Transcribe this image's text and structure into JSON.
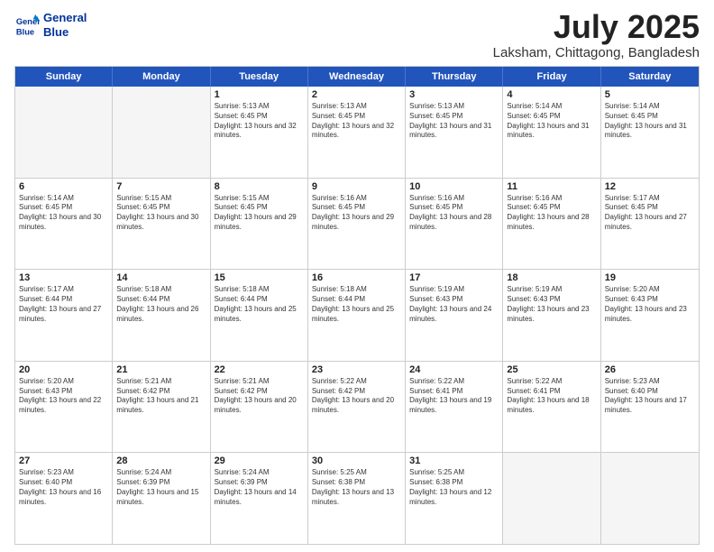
{
  "header": {
    "logo_line1": "General",
    "logo_line2": "Blue",
    "month": "July 2025",
    "location": "Laksham, Chittagong, Bangladesh"
  },
  "weekdays": [
    "Sunday",
    "Monday",
    "Tuesday",
    "Wednesday",
    "Thursday",
    "Friday",
    "Saturday"
  ],
  "rows": [
    [
      {
        "day": "",
        "info": ""
      },
      {
        "day": "",
        "info": ""
      },
      {
        "day": "1",
        "info": "Sunrise: 5:13 AM\nSunset: 6:45 PM\nDaylight: 13 hours and 32 minutes."
      },
      {
        "day": "2",
        "info": "Sunrise: 5:13 AM\nSunset: 6:45 PM\nDaylight: 13 hours and 32 minutes."
      },
      {
        "day": "3",
        "info": "Sunrise: 5:13 AM\nSunset: 6:45 PM\nDaylight: 13 hours and 31 minutes."
      },
      {
        "day": "4",
        "info": "Sunrise: 5:14 AM\nSunset: 6:45 PM\nDaylight: 13 hours and 31 minutes."
      },
      {
        "day": "5",
        "info": "Sunrise: 5:14 AM\nSunset: 6:45 PM\nDaylight: 13 hours and 31 minutes."
      }
    ],
    [
      {
        "day": "6",
        "info": "Sunrise: 5:14 AM\nSunset: 6:45 PM\nDaylight: 13 hours and 30 minutes."
      },
      {
        "day": "7",
        "info": "Sunrise: 5:15 AM\nSunset: 6:45 PM\nDaylight: 13 hours and 30 minutes."
      },
      {
        "day": "8",
        "info": "Sunrise: 5:15 AM\nSunset: 6:45 PM\nDaylight: 13 hours and 29 minutes."
      },
      {
        "day": "9",
        "info": "Sunrise: 5:16 AM\nSunset: 6:45 PM\nDaylight: 13 hours and 29 minutes."
      },
      {
        "day": "10",
        "info": "Sunrise: 5:16 AM\nSunset: 6:45 PM\nDaylight: 13 hours and 28 minutes."
      },
      {
        "day": "11",
        "info": "Sunrise: 5:16 AM\nSunset: 6:45 PM\nDaylight: 13 hours and 28 minutes."
      },
      {
        "day": "12",
        "info": "Sunrise: 5:17 AM\nSunset: 6:45 PM\nDaylight: 13 hours and 27 minutes."
      }
    ],
    [
      {
        "day": "13",
        "info": "Sunrise: 5:17 AM\nSunset: 6:44 PM\nDaylight: 13 hours and 27 minutes."
      },
      {
        "day": "14",
        "info": "Sunrise: 5:18 AM\nSunset: 6:44 PM\nDaylight: 13 hours and 26 minutes."
      },
      {
        "day": "15",
        "info": "Sunrise: 5:18 AM\nSunset: 6:44 PM\nDaylight: 13 hours and 25 minutes."
      },
      {
        "day": "16",
        "info": "Sunrise: 5:18 AM\nSunset: 6:44 PM\nDaylight: 13 hours and 25 minutes."
      },
      {
        "day": "17",
        "info": "Sunrise: 5:19 AM\nSunset: 6:43 PM\nDaylight: 13 hours and 24 minutes."
      },
      {
        "day": "18",
        "info": "Sunrise: 5:19 AM\nSunset: 6:43 PM\nDaylight: 13 hours and 23 minutes."
      },
      {
        "day": "19",
        "info": "Sunrise: 5:20 AM\nSunset: 6:43 PM\nDaylight: 13 hours and 23 minutes."
      }
    ],
    [
      {
        "day": "20",
        "info": "Sunrise: 5:20 AM\nSunset: 6:43 PM\nDaylight: 13 hours and 22 minutes."
      },
      {
        "day": "21",
        "info": "Sunrise: 5:21 AM\nSunset: 6:42 PM\nDaylight: 13 hours and 21 minutes."
      },
      {
        "day": "22",
        "info": "Sunrise: 5:21 AM\nSunset: 6:42 PM\nDaylight: 13 hours and 20 minutes."
      },
      {
        "day": "23",
        "info": "Sunrise: 5:22 AM\nSunset: 6:42 PM\nDaylight: 13 hours and 20 minutes."
      },
      {
        "day": "24",
        "info": "Sunrise: 5:22 AM\nSunset: 6:41 PM\nDaylight: 13 hours and 19 minutes."
      },
      {
        "day": "25",
        "info": "Sunrise: 5:22 AM\nSunset: 6:41 PM\nDaylight: 13 hours and 18 minutes."
      },
      {
        "day": "26",
        "info": "Sunrise: 5:23 AM\nSunset: 6:40 PM\nDaylight: 13 hours and 17 minutes."
      }
    ],
    [
      {
        "day": "27",
        "info": "Sunrise: 5:23 AM\nSunset: 6:40 PM\nDaylight: 13 hours and 16 minutes."
      },
      {
        "day": "28",
        "info": "Sunrise: 5:24 AM\nSunset: 6:39 PM\nDaylight: 13 hours and 15 minutes."
      },
      {
        "day": "29",
        "info": "Sunrise: 5:24 AM\nSunset: 6:39 PM\nDaylight: 13 hours and 14 minutes."
      },
      {
        "day": "30",
        "info": "Sunrise: 5:25 AM\nSunset: 6:38 PM\nDaylight: 13 hours and 13 minutes."
      },
      {
        "day": "31",
        "info": "Sunrise: 5:25 AM\nSunset: 6:38 PM\nDaylight: 13 hours and 12 minutes."
      },
      {
        "day": "",
        "info": ""
      },
      {
        "day": "",
        "info": ""
      }
    ]
  ]
}
